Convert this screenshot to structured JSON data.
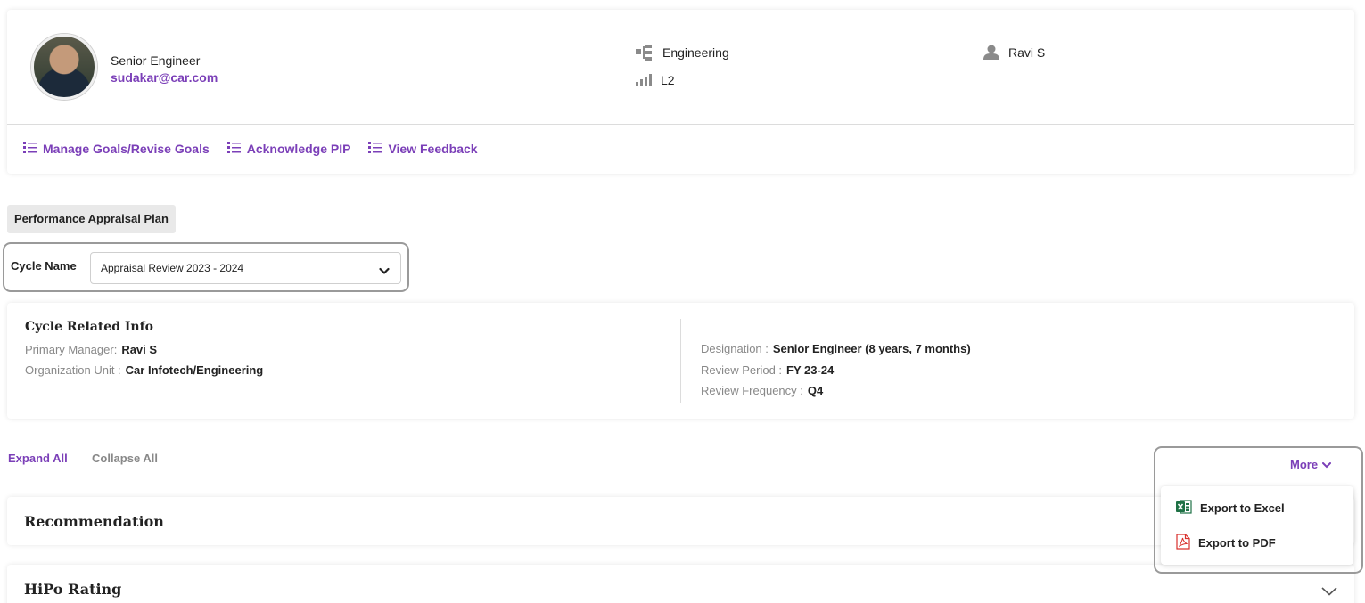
{
  "profile": {
    "role": "Senior Engineer",
    "email": "sudakar@car.com",
    "department": "Engineering",
    "level": "L2",
    "manager": "Ravi S",
    "icons": {
      "department": "org-chart-icon",
      "level": "signal-bars-icon",
      "manager": "person-icon"
    }
  },
  "actions": [
    {
      "label": "Manage Goals/Revise Goals",
      "icon": "list-icon"
    },
    {
      "label": "Acknowledge PIP",
      "icon": "list-icon"
    },
    {
      "label": "View Feedback",
      "icon": "list-icon"
    }
  ],
  "section_tag": "Performance Appraisal Plan",
  "cycle": {
    "label": "Cycle Name",
    "selected": "Appraisal Review 2023 - 2024"
  },
  "cycle_info": {
    "title": "Cycle Related Info",
    "primary_manager_label": "Primary Manager:",
    "primary_manager": "Ravi S",
    "org_unit_label": "Organization Unit :",
    "org_unit": "Car Infotech/Engineering",
    "designation_label": "Designation :",
    "designation": "Senior Engineer (8 years, 7 months)",
    "review_period_label": "Review Period :",
    "review_period": "FY 23-24",
    "review_frequency_label": "Review Frequency :",
    "review_frequency": "Q4"
  },
  "controls": {
    "expand_all": "Expand All",
    "collapse_all": "Collapse All",
    "more": "More"
  },
  "export_menu": {
    "excel": "Export to Excel",
    "pdf": "Export to PDF"
  },
  "panels": {
    "recommendation": "Recommendation",
    "hipo": "HiPo Rating"
  },
  "colors": {
    "accent": "#7b3fb8",
    "excel": "#1e7145",
    "pdf": "#d9302c"
  }
}
